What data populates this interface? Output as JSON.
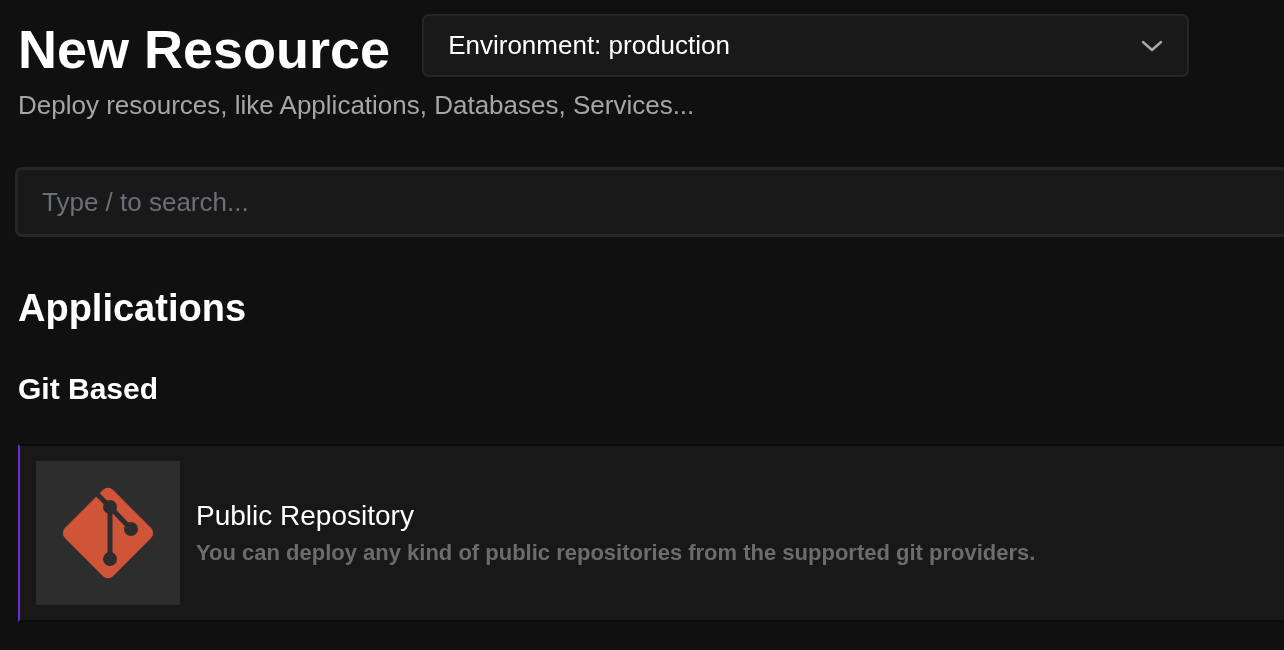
{
  "header": {
    "title": "New Resource",
    "subtitle": "Deploy resources, like Applications, Databases, Services..."
  },
  "environment_select": {
    "value": "Environment: production"
  },
  "search": {
    "placeholder": "Type / to search..."
  },
  "sections": [
    {
      "title": "Applications",
      "groups": [
        {
          "title": "Git Based",
          "items": [
            {
              "title": "Public Repository",
              "description": "You can deploy any kind of public repositories from the supported git providers.",
              "selected": true
            }
          ]
        }
      ]
    }
  ]
}
